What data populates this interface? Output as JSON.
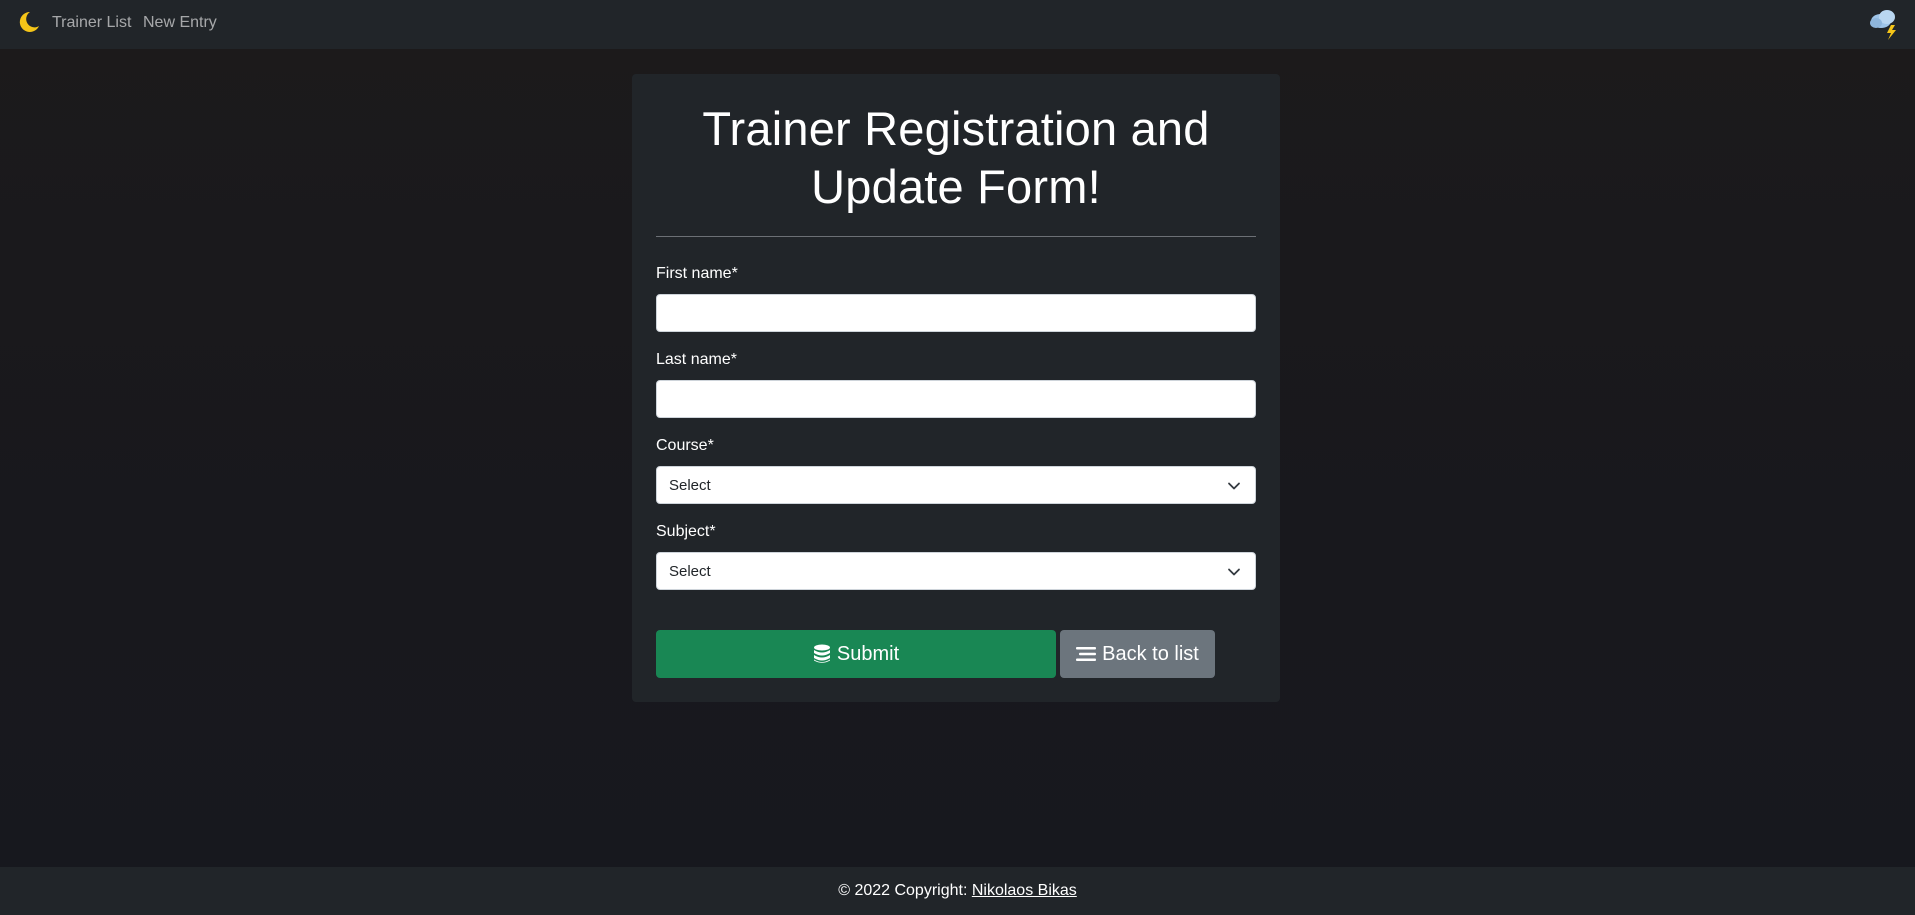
{
  "nav": {
    "brand_icon": "moon-icon",
    "links": [
      "Trainer List",
      "New Entry"
    ],
    "weather_icon": "cloud-storm-icon"
  },
  "form": {
    "title_line1": "Trainer Registration and",
    "title_line2": "Update Form!",
    "first_name_label": "First name*",
    "first_name_value": "",
    "last_name_label": "Last name*",
    "last_name_value": "",
    "course_label": "Course*",
    "course_selected": "Select",
    "subject_label": "Subject*",
    "subject_selected": "Select",
    "submit_label": "Submit",
    "submit_icon": "database-icon",
    "back_label": "Back to list",
    "back_icon": "list-icon"
  },
  "footer": {
    "prefix": "© 2022 Copyright: ",
    "author": "Nikolaos Bikas"
  },
  "colors": {
    "navbar_bg": "#212529",
    "card_bg": "#212529",
    "submit_bg": "#198754",
    "back_bg": "#6c757d",
    "moon": "#f5c518"
  }
}
